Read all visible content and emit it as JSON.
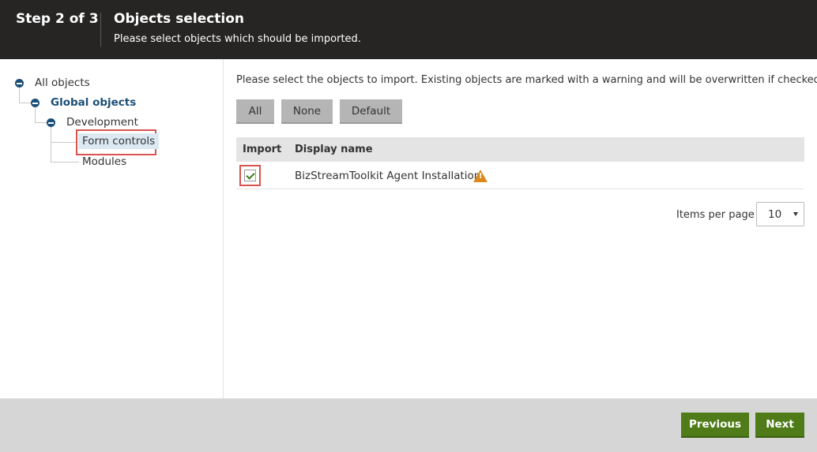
{
  "header": {
    "step": "Step 2 of 3",
    "title": "Objects selection",
    "subtitle": "Please select objects which should be imported."
  },
  "tree": {
    "root": "All objects",
    "global": "Global objects",
    "development": "Development",
    "form_controls": "Form controls",
    "modules": "Modules"
  },
  "main": {
    "info": "Please select the objects to import. Existing objects are marked with a warning and will be overwritten if checked.",
    "buttons": {
      "all": "All",
      "none": "None",
      "default": "Default"
    },
    "table": {
      "headers": {
        "import": "Import",
        "display_name": "Display name"
      },
      "rows": [
        {
          "checked": true,
          "name": "BizStreamToolkit Agent Installation",
          "warning": true
        }
      ]
    },
    "items_per_page_label": "Items per page",
    "items_per_page_value": "10"
  },
  "footer": {
    "previous": "Previous",
    "next": "Next"
  },
  "colors": {
    "header_bg": "#262524",
    "accent_green": "#4f7c19",
    "tree_blue": "#1b4f78",
    "warning": "#d9891c",
    "highlight": "#d9534f"
  }
}
